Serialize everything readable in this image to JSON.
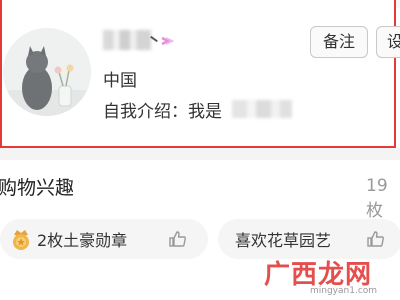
{
  "profile": {
    "location": "中国",
    "intro_label": "自我介绍：我是",
    "note_button": "备注",
    "settings_button": "设"
  },
  "interests": {
    "title": "购物兴趣",
    "count": "19枚",
    "chips": [
      {
        "label": "2枚土豪勋章",
        "icon": "medal-icon"
      },
      {
        "label": "喜欢花草园艺",
        "icon": ""
      }
    ]
  },
  "watermark": {
    "brand": "广西龙网",
    "url": "mingyan1.com"
  },
  "colors": {
    "card_border": "#e23a3a",
    "gender_icon": "#e58fd6",
    "watermark": "#e0302d"
  }
}
